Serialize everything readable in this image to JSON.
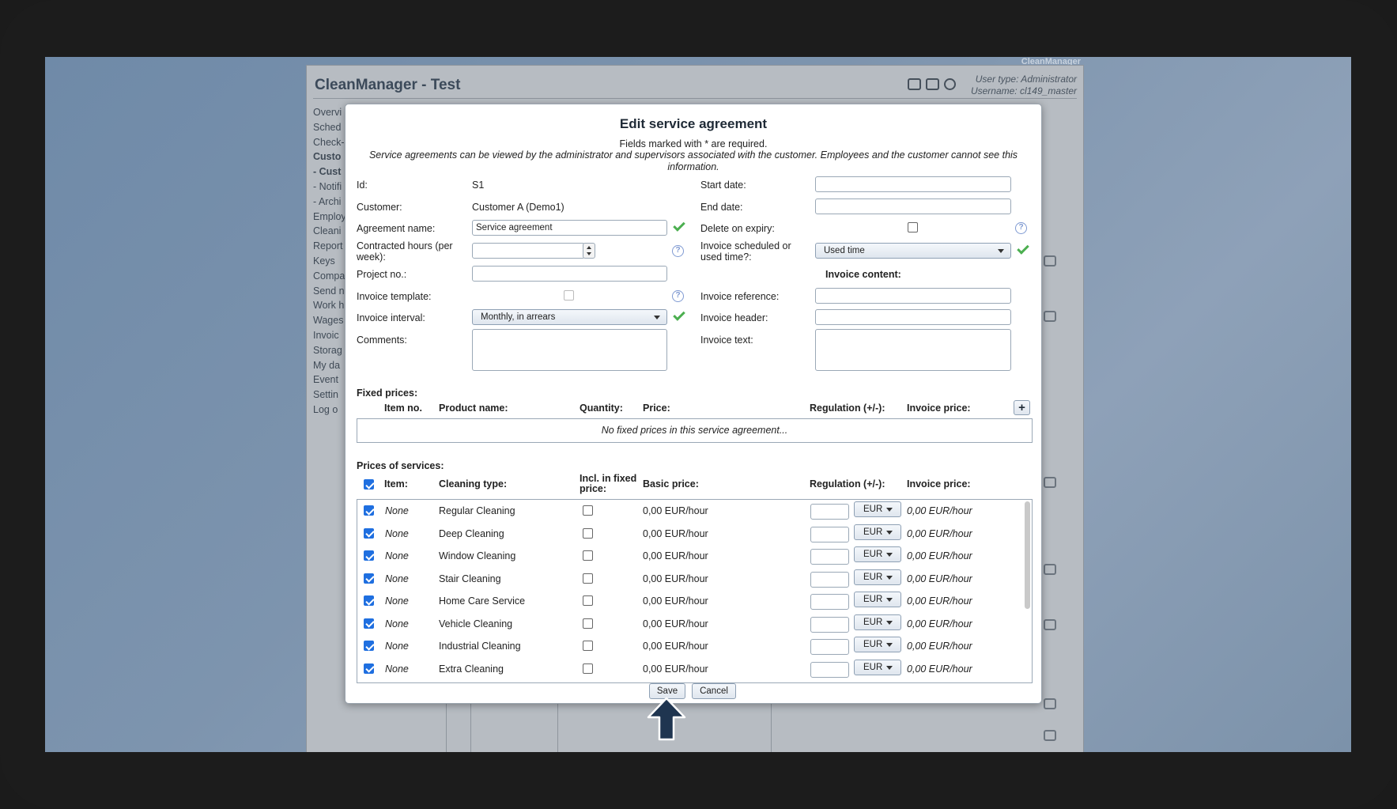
{
  "screen": {
    "label": "CleanManager"
  },
  "app": {
    "title": "CleanManager - Test",
    "user_type": "User type: Administrator",
    "username": "Username: cl149_master",
    "menu": [
      "Overvi",
      "Sched",
      "Check-",
      "Custo",
      " - Cust",
      " - Notifi",
      " - Archi",
      "Employ",
      "Cleani",
      "Report",
      "Keys",
      "Compa",
      "Send n",
      "Work h",
      "Wages",
      "Invoic",
      "Storag",
      "My da",
      "Event",
      "Settin",
      "Log o"
    ]
  },
  "modal": {
    "title": "Edit service agreement",
    "required_note": "Fields marked with * are required.",
    "visibility_note": "Service agreements can be viewed by the administrator and supervisors associated with the customer. Employees and the customer cannot see this information.",
    "left": {
      "id_label": "Id:",
      "id_value": "S1",
      "customer_label": "Customer:",
      "customer_value": "Customer A (Demo1)",
      "agreement_name_label": "Agreement name:",
      "agreement_name_value": "Service agreement",
      "contracted_hours_label": "Contracted hours (per week):",
      "contracted_hours_value": "",
      "project_no_label": "Project no.:",
      "project_no_value": "",
      "invoice_template_label": "Invoice template:",
      "invoice_interval_label": "Invoice interval:",
      "invoice_interval_value": "Monthly, in arrears",
      "comments_label": "Comments:",
      "comments_value": ""
    },
    "right": {
      "start_date_label": "Start date:",
      "start_date_value": "",
      "end_date_label": "End date:",
      "end_date_value": "",
      "delete_on_expiry_label": "Delete on expiry:",
      "invoice_sched_label": "Invoice scheduled or used time?:",
      "invoice_sched_value": "Used time",
      "invoice_content_heading": "Invoice content:",
      "invoice_reference_label": "Invoice reference:",
      "invoice_reference_value": "",
      "invoice_header_label": "Invoice header:",
      "invoice_header_value": "",
      "invoice_text_label": "Invoice text:",
      "invoice_text_value": ""
    },
    "fixed_prices": {
      "heading": "Fixed prices:",
      "columns": [
        "Item no.",
        "Product name:",
        "Quantity:",
        "Price:",
        "Regulation (+/-):",
        "Invoice price:"
      ],
      "add_label": "+",
      "empty": "No fixed prices in this service agreement..."
    },
    "services": {
      "heading": "Prices of services:",
      "columns": [
        "Item:",
        "Cleaning type:",
        "Incl. in fixed price:",
        "Basic price:",
        "Regulation (+/-):",
        "Invoice price:"
      ],
      "rows": [
        {
          "item": "None",
          "type": "Regular Cleaning",
          "basic": "0,00 EUR/hour",
          "reg": "",
          "currency": "EUR",
          "invoice": "0,00 EUR/hour"
        },
        {
          "item": "None",
          "type": "Deep Cleaning",
          "basic": "0,00 EUR/hour",
          "reg": "",
          "currency": "EUR",
          "invoice": "0,00 EUR/hour"
        },
        {
          "item": "None",
          "type": "Window Cleaning",
          "basic": "0,00 EUR/hour",
          "reg": "",
          "currency": "EUR",
          "invoice": "0,00 EUR/hour"
        },
        {
          "item": "None",
          "type": "Stair Cleaning",
          "basic": "0,00 EUR/hour",
          "reg": "",
          "currency": "EUR",
          "invoice": "0,00 EUR/hour"
        },
        {
          "item": "None",
          "type": "Home Care Service",
          "basic": "0,00 EUR/hour",
          "reg": "",
          "currency": "EUR",
          "invoice": "0,00 EUR/hour"
        },
        {
          "item": "None",
          "type": "Vehicle Cleaning",
          "basic": "0,00 EUR/hour",
          "reg": "",
          "currency": "EUR",
          "invoice": "0,00 EUR/hour"
        },
        {
          "item": "None",
          "type": "Industrial Cleaning",
          "basic": "0,00 EUR/hour",
          "reg": "",
          "currency": "EUR",
          "invoice": "0,00 EUR/hour"
        },
        {
          "item": "None",
          "type": "Extra Cleaning",
          "basic": "0,00 EUR/hour",
          "reg": "",
          "currency": "EUR",
          "invoice": "0,00 EUR/hour"
        }
      ]
    },
    "save_label": "Save",
    "cancel_label": "Cancel"
  },
  "colors": {
    "accent": "#1f6fe0",
    "check": "#4caf50",
    "pointer": "#1f3550"
  }
}
